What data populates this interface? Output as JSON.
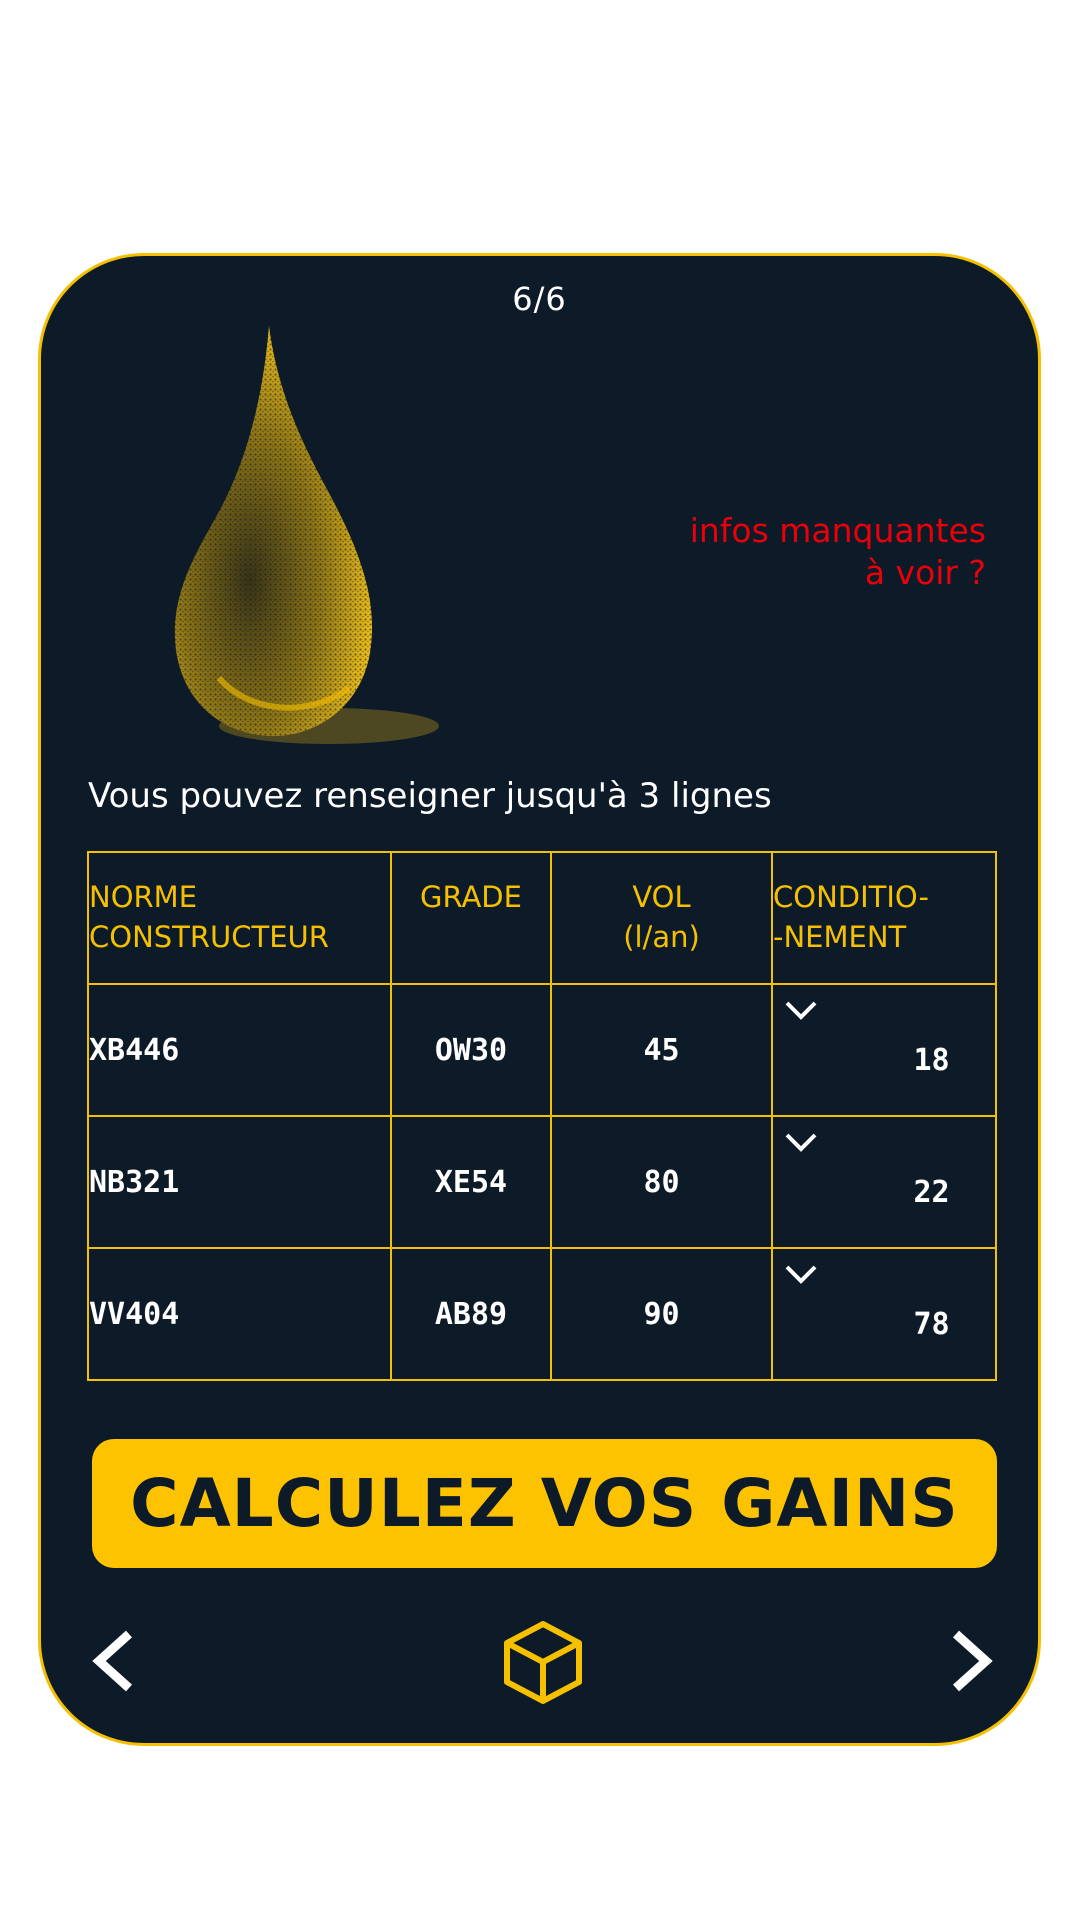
{
  "header": {
    "page_counter": "6/6",
    "missing_info_line1": "infos manquantes",
    "missing_info_line2": "à voir ?"
  },
  "instruction": "Vous pouvez renseigner jusqu'à 3 lignes",
  "table": {
    "headers": {
      "norme_line1": "NORME",
      "norme_line2": "CONSTRUCTEUR",
      "grade": "GRADE",
      "vol_line1": "VOL",
      "vol_line2": "(l/an)",
      "cond_line1": "CONDITIO-",
      "cond_line2": "-NEMENT"
    },
    "rows": [
      {
        "norme": "XB446",
        "grade": "OW30",
        "vol": "45",
        "cond": "18"
      },
      {
        "norme": "NB321",
        "grade": "XE54",
        "vol": "80",
        "cond": "22"
      },
      {
        "norme": "VV404",
        "grade": "AB89",
        "vol": "90",
        "cond": "78"
      }
    ]
  },
  "cta_label": "CALCULEZ VOS GAINS",
  "icons": {
    "drop": "oil-drop-icon",
    "prev": "chevron-left-icon",
    "next": "chevron-right-icon",
    "home": "cube-icon",
    "dropdown": "chevron-down-icon"
  },
  "colors": {
    "background": "#0d1a28",
    "accent": "#f5c000",
    "button": "#fdc300",
    "alert": "#e8000a",
    "text": "#ffffff"
  }
}
